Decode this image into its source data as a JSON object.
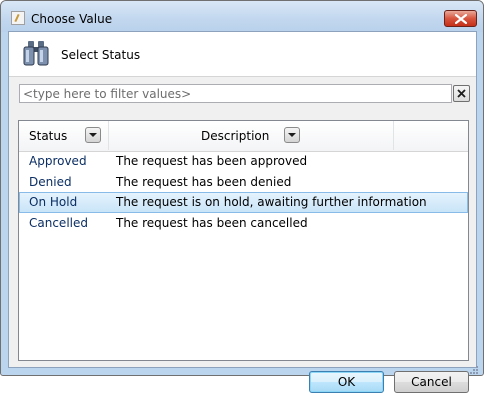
{
  "window": {
    "title": "Choose Value",
    "close_icon": "close-x-icon"
  },
  "header": {
    "icon": "binoculars-icon",
    "label": "Select Status"
  },
  "filter": {
    "value": "",
    "placeholder": "<type here to filter values>",
    "clear_icon": "clear-x-icon"
  },
  "grid": {
    "columns": [
      {
        "label": "Status",
        "filter_icon": "dropdown-filter-icon"
      },
      {
        "label": "Description",
        "filter_icon": "dropdown-filter-icon"
      }
    ],
    "rows": [
      {
        "status": "Approved",
        "description": "The request has been approved",
        "selected": false
      },
      {
        "status": "Denied",
        "description": "The request has been denied",
        "selected": false
      },
      {
        "status": "On Hold",
        "description": "The request is on hold, awaiting further information",
        "selected": true
      },
      {
        "status": "Cancelled",
        "description": "The request has been cancelled",
        "selected": false
      }
    ]
  },
  "footer": {
    "ok_label": "OK",
    "cancel_label": "Cancel"
  },
  "colors": {
    "accent": "#c9e4f8",
    "selection_border": "#88bbe8",
    "close_button": "#d7553f"
  }
}
